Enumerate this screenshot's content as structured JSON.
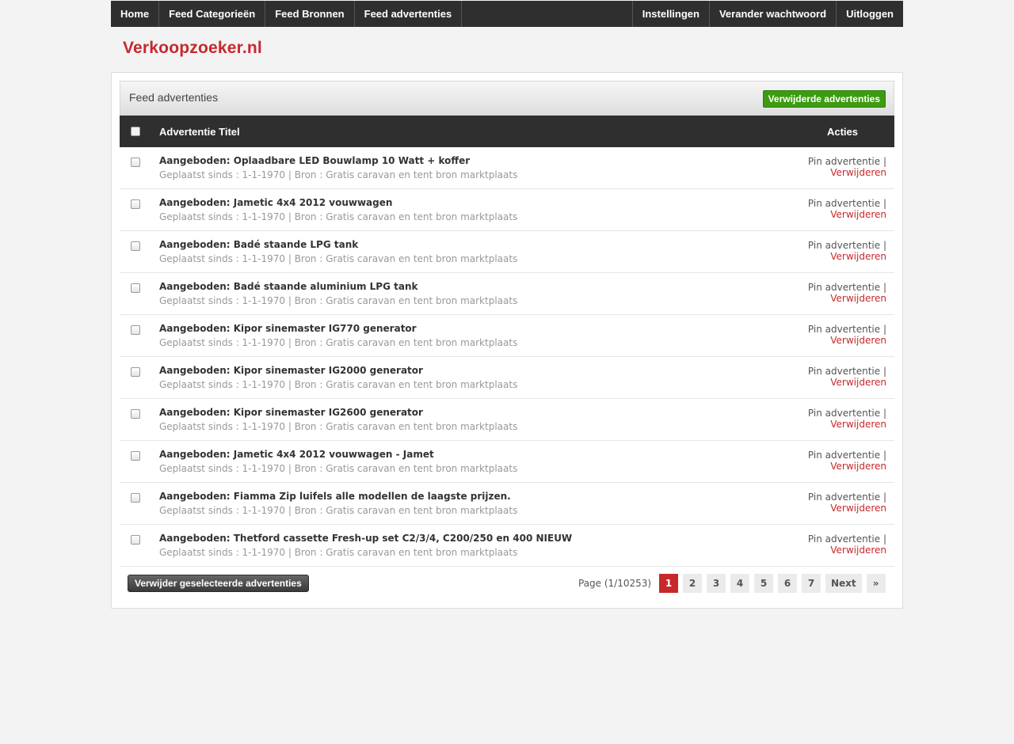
{
  "nav": {
    "left": [
      "Home",
      "Feed Categorieën",
      "Feed Bronnen",
      "Feed advertenties"
    ],
    "right": [
      "Instellingen",
      "Verander wachtwoord",
      "Uitloggen"
    ]
  },
  "logo": "Verkoopzoeker.nl",
  "panel": {
    "title": "Feed advertenties",
    "deleted_button": "Verwijderde advertenties"
  },
  "table": {
    "col_title": "Advertentie Titel",
    "col_actions": "Acties",
    "pin_label": "Pin advertentie",
    "separator": "|",
    "delete_label": "Verwijderen",
    "rows": [
      {
        "title": "Aangeboden: Oplaadbare LED Bouwlamp 10 Watt + koffer",
        "meta": "Geplaatst sinds : 1-1-1970 | Bron : Gratis caravan en tent bron marktplaats"
      },
      {
        "title": "Aangeboden: Jametic 4x4 2012 vouwwagen",
        "meta": "Geplaatst sinds : 1-1-1970 | Bron : Gratis caravan en tent bron marktplaats"
      },
      {
        "title": "Aangeboden: Badé staande LPG tank",
        "meta": "Geplaatst sinds : 1-1-1970 | Bron : Gratis caravan en tent bron marktplaats"
      },
      {
        "title": "Aangeboden: Badé staande aluminium LPG tank",
        "meta": "Geplaatst sinds : 1-1-1970 | Bron : Gratis caravan en tent bron marktplaats"
      },
      {
        "title": "Aangeboden: Kipor sinemaster IG770 generator",
        "meta": "Geplaatst sinds : 1-1-1970 | Bron : Gratis caravan en tent bron marktplaats"
      },
      {
        "title": "Aangeboden: Kipor sinemaster IG2000 generator",
        "meta": "Geplaatst sinds : 1-1-1970 | Bron : Gratis caravan en tent bron marktplaats"
      },
      {
        "title": "Aangeboden: Kipor sinemaster IG2600 generator",
        "meta": "Geplaatst sinds : 1-1-1970 | Bron : Gratis caravan en tent bron marktplaats"
      },
      {
        "title": "Aangeboden: Jametic 4x4 2012 vouwwagen - Jamet",
        "meta": "Geplaatst sinds : 1-1-1970 | Bron : Gratis caravan en tent bron marktplaats"
      },
      {
        "title": "Aangeboden: Fiamma Zip luifels alle modellen de laagste prijzen.",
        "meta": "Geplaatst sinds : 1-1-1970 | Bron : Gratis caravan en tent bron marktplaats"
      },
      {
        "title": "Aangeboden: Thetford cassette Fresh-up set C2/3/4, C200/250 en 400 NIEUW",
        "meta": "Geplaatst sinds : 1-1-1970 | Bron : Gratis caravan en tent bron marktplaats"
      }
    ]
  },
  "footer": {
    "delete_selected": "Verwijder geselecteerde advertenties",
    "page_info": "Page (1/10253)",
    "pages": [
      "1",
      "2",
      "3",
      "4",
      "5",
      "6",
      "7",
      "Next",
      "»"
    ],
    "current_page": "1"
  },
  "colors": {
    "brand_red": "#c7282c",
    "nav_dark": "#2f2f2f",
    "green": "#3d9b12"
  }
}
